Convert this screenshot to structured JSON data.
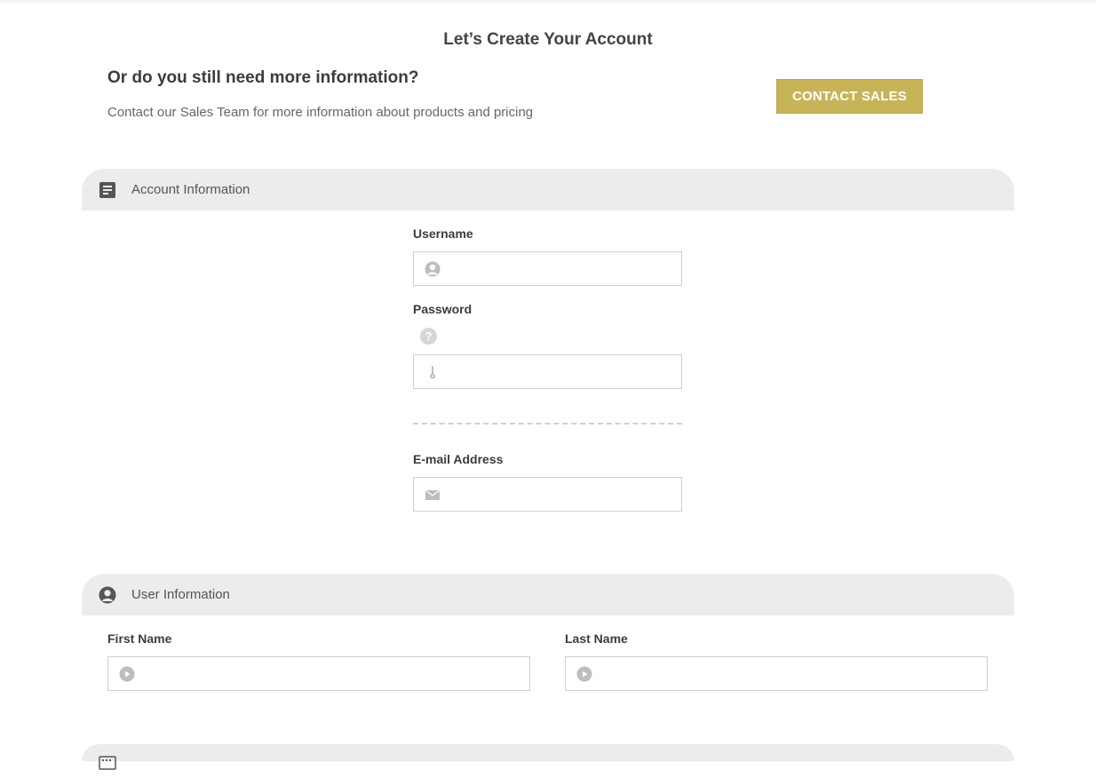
{
  "page": {
    "title": "Let’s Create Your Account"
  },
  "sales": {
    "heading": "Or do you still need more information?",
    "subtext": "Contact our Sales Team for more information about products and pricing",
    "button_label": "CONTACT SALES"
  },
  "account_section": {
    "title": "Account Information",
    "icon": "document-icon",
    "username_label": "Username",
    "username_value": "",
    "password_label": "Password",
    "password_value": "",
    "email_label": "E-mail Address",
    "email_value": ""
  },
  "user_section": {
    "title": "User Information",
    "icon": "user-icon",
    "first_name_label": "First Name",
    "first_name_value": "",
    "last_name_label": "Last Name",
    "last_name_value": ""
  },
  "colors": {
    "accent": "#c8b458",
    "section_bg": "#ececec",
    "icon_gray": "#bdbdbd"
  }
}
